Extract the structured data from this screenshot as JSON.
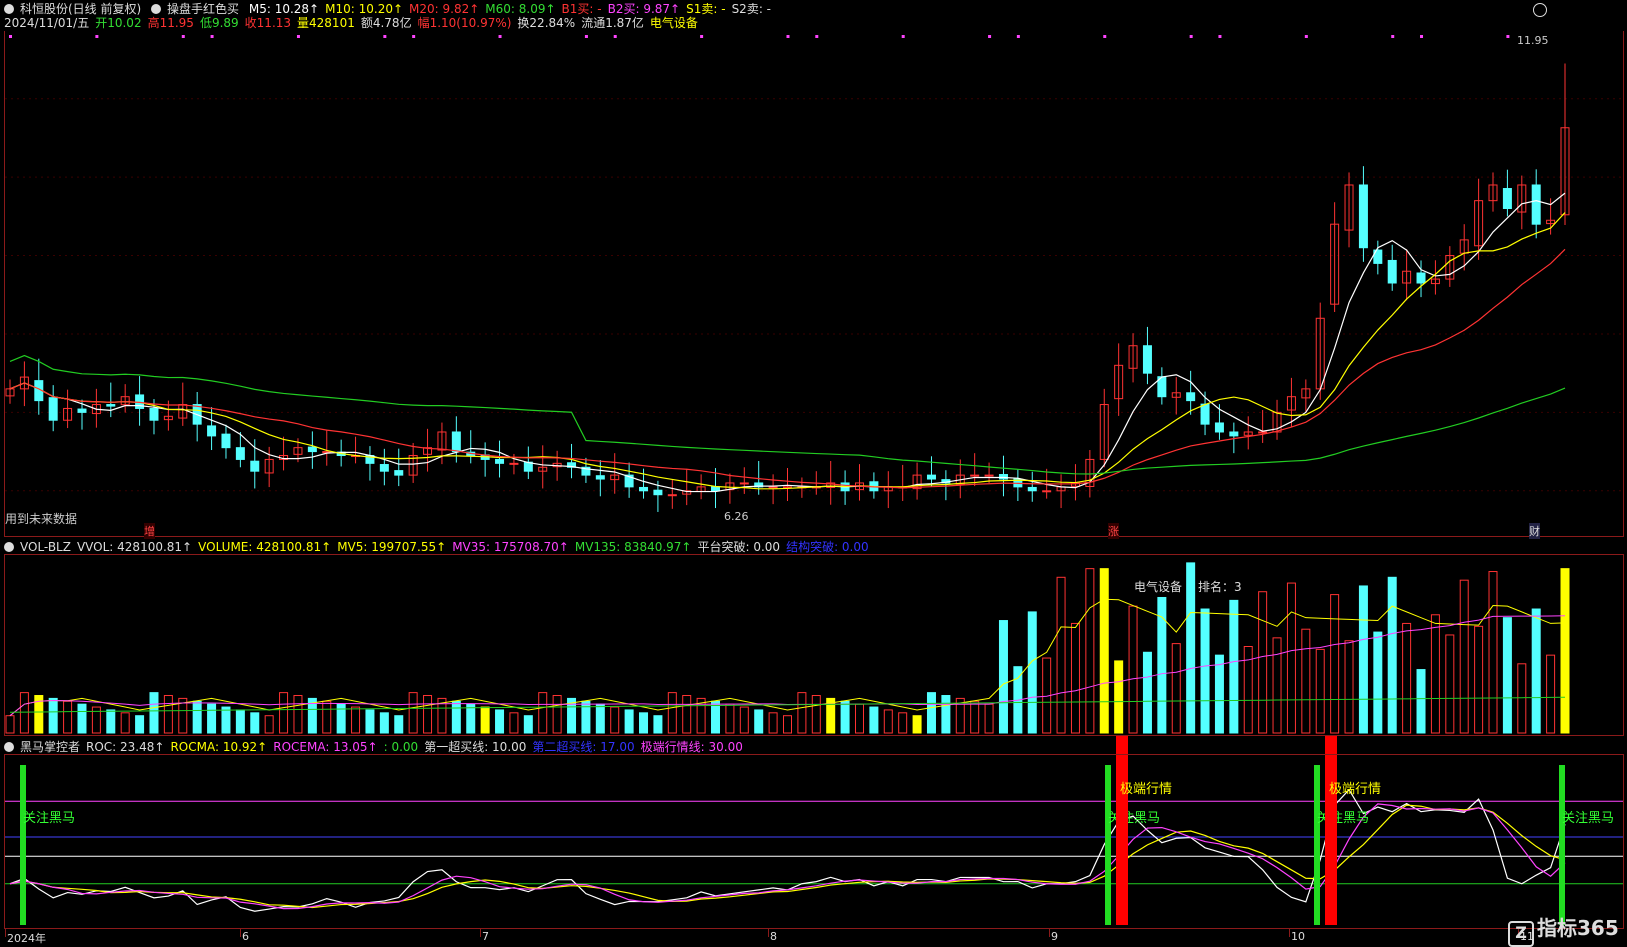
{
  "main": {
    "title": "科恒股份(日线 前复权)",
    "indicator_name": "操盘手红色买",
    "ma": [
      {
        "label": "M5: 10.28↑",
        "color": "#ffffff"
      },
      {
        "label": "M10: 10.20↑",
        "color": "#ffff00"
      },
      {
        "label": "M20: 9.82↑",
        "color": "#ff3333"
      },
      {
        "label": "M60: 8.09↑",
        "color": "#33dd33"
      },
      {
        "label": "B1买: -",
        "color": "#ff3333"
      },
      {
        "label": "B2买: 9.87↑",
        "color": "#ff44ff"
      },
      {
        "label": "S1卖: -",
        "color": "#ffff00"
      },
      {
        "label": "S2卖: -",
        "color": "#dddddd"
      }
    ],
    "quote": [
      {
        "label": "2024/11/01/五",
        "color": "#dddddd"
      },
      {
        "label": "开10.02",
        "color": "#33dd33"
      },
      {
        "label": "高11.95",
        "color": "#ff3333"
      },
      {
        "label": "低9.89",
        "color": "#33dd33"
      },
      {
        "label": "收11.13",
        "color": "#ff3333"
      },
      {
        "label": "量428101",
        "color": "#ffff00"
      },
      {
        "label": "额4.78亿",
        "color": "#dddddd"
      },
      {
        "label": "幅1.10(10.97%)",
        "color": "#ff3333"
      },
      {
        "label": "换22.84%",
        "color": "#dddddd"
      },
      {
        "label": "流通1.87亿",
        "color": "#dddddd"
      },
      {
        "label": "电气设备",
        "color": "#ffff00"
      }
    ],
    "future_note": "用到未来数据",
    "high_label": "11.95",
    "low_label": "6.26",
    "markers": [
      {
        "text": "增"
      },
      {
        "text": "涨"
      },
      {
        "text": "财"
      }
    ]
  },
  "volume": {
    "name": "VOL-BLZ",
    "items": [
      {
        "label": "VVOL: 428100.81↑",
        "color": "#dddddd"
      },
      {
        "label": "VOLUME: 428100.81↑",
        "color": "#ffff00"
      },
      {
        "label": "MV5: 199707.55↑",
        "color": "#ffff00"
      },
      {
        "label": "MV35: 175708.70↑",
        "color": "#ff44ff"
      },
      {
        "label": "MV135: 83840.97↑",
        "color": "#33dd33"
      },
      {
        "label": "平台突破: 0.00",
        "color": "#dddddd"
      },
      {
        "label": "结构突破: 0.00",
        "color": "#3333ff"
      }
    ],
    "sector": "电气设备",
    "rank_label": "排名：",
    "rank_value": "3"
  },
  "roc": {
    "name": "黑马掌控者",
    "items": [
      {
        "label": "ROC: 23.48↑",
        "color": "#dddddd"
      },
      {
        "label": "ROCMA: 10.92↑",
        "color": "#ffff00"
      },
      {
        "label": "ROCEMA: 13.05↑",
        "color": "#ff44ff"
      },
      {
        "label": ": 0.00",
        "color": "#33dd33"
      },
      {
        "label": "第一超买线: 10.00",
        "color": "#dddddd"
      },
      {
        "label": "第二超买线: 17.00",
        "color": "#3333ff"
      },
      {
        "label": "极端行情线: 30.00",
        "color": "#ff44ff"
      }
    ],
    "signal_green": "关注黑马",
    "signal_red": "极端行情"
  },
  "x_axis": {
    "labels": [
      "2024年",
      "6",
      "7",
      "8",
      "9",
      "10",
      "11"
    ]
  },
  "logo": "指标365",
  "chart_data": {
    "type": "candlestick",
    "title": "科恒股份(日线 前复权)",
    "ohlc_sample": [
      {
        "date": "2024/11/01",
        "open": 10.02,
        "high": 11.95,
        "low": 9.89,
        "close": 11.13,
        "volume": 428101
      }
    ],
    "closes": [
      7.8,
      7.95,
      7.65,
      7.4,
      7.55,
      7.5,
      7.6,
      7.58,
      7.7,
      7.55,
      7.4,
      7.45,
      7.6,
      7.35,
      7.2,
      7.05,
      6.9,
      6.75,
      6.9,
      6.95,
      7.05,
      7.0,
      7.0,
      6.95,
      6.95,
      6.85,
      6.75,
      6.7,
      6.95,
      7.05,
      7.25,
      7.0,
      6.95,
      6.9,
      6.85,
      6.85,
      6.75,
      6.8,
      6.85,
      6.8,
      6.7,
      6.65,
      6.7,
      6.55,
      6.5,
      6.45,
      6.45,
      6.5,
      6.55,
      6.5,
      6.6,
      6.6,
      6.55,
      6.55,
      6.55,
      6.55,
      6.55,
      6.6,
      6.5,
      6.6,
      6.5,
      6.55,
      6.55,
      6.7,
      6.65,
      6.6,
      6.7,
      6.7,
      6.7,
      6.65,
      6.55,
      6.5,
      6.5,
      6.55,
      6.6,
      6.9,
      7.6,
      8.1,
      8.35,
      8.0,
      7.7,
      7.75,
      7.65,
      7.35,
      7.25,
      7.2,
      7.25,
      7.25,
      7.5,
      7.7,
      7.8,
      8.7,
      9.9,
      10.4,
      9.6,
      9.4,
      9.15,
      9.3,
      9.15,
      9.2,
      9.5,
      9.7,
      10.2,
      10.4,
      10.1,
      10.4,
      9.9,
      9.95,
      11.13
    ],
    "ma5": {
      "last": 10.28
    },
    "ma10": {
      "last": 10.2
    },
    "ma20": {
      "last": 9.82
    },
    "ma60": {
      "last": 8.09
    },
    "volume_last": 428100.81,
    "mv5": 199707.55,
    "mv35": 175708.7,
    "mv135": 83840.97,
    "roc_last": 23.48,
    "rocma": 10.92,
    "rocema": 13.05,
    "roc_levels": {
      "first_overbought": 10.0,
      "second_overbought": 17.0,
      "extreme": 30.0
    },
    "price_high": 11.95,
    "price_low": 6.26
  }
}
